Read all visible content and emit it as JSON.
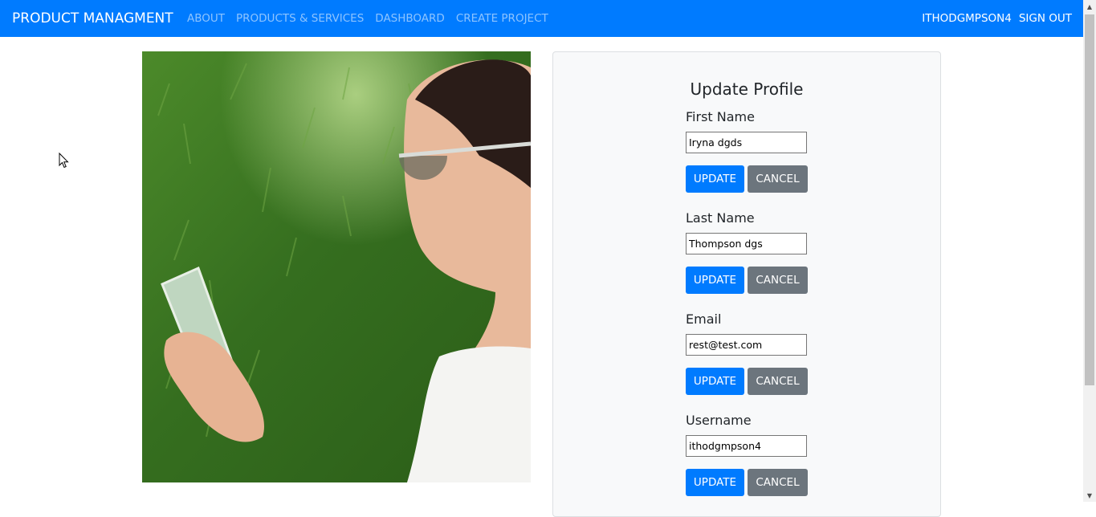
{
  "nav": {
    "brand": "PRODUCT MANAGMENT",
    "links": [
      "ABOUT",
      "PRODUCTS & SERVICES",
      "DASHBOARD",
      "CREATE PROJECT"
    ],
    "user": "ITHODGMPSON4",
    "signout": "SIGN OUT"
  },
  "form": {
    "title": "Update Profile",
    "fields": [
      {
        "label": "First Name",
        "value": "Iryna dgds"
      },
      {
        "label": "Last Name",
        "value": "Thompson dgs"
      },
      {
        "label": "Email",
        "value": "rest@test.com"
      },
      {
        "label": "Username",
        "value": "ithodgmpson4"
      }
    ],
    "update_label": "UPDATE",
    "cancel_label": "CANCEL"
  },
  "colors": {
    "primary": "#007bff",
    "secondary": "#6c757d",
    "card_bg": "#f8f9fa"
  }
}
